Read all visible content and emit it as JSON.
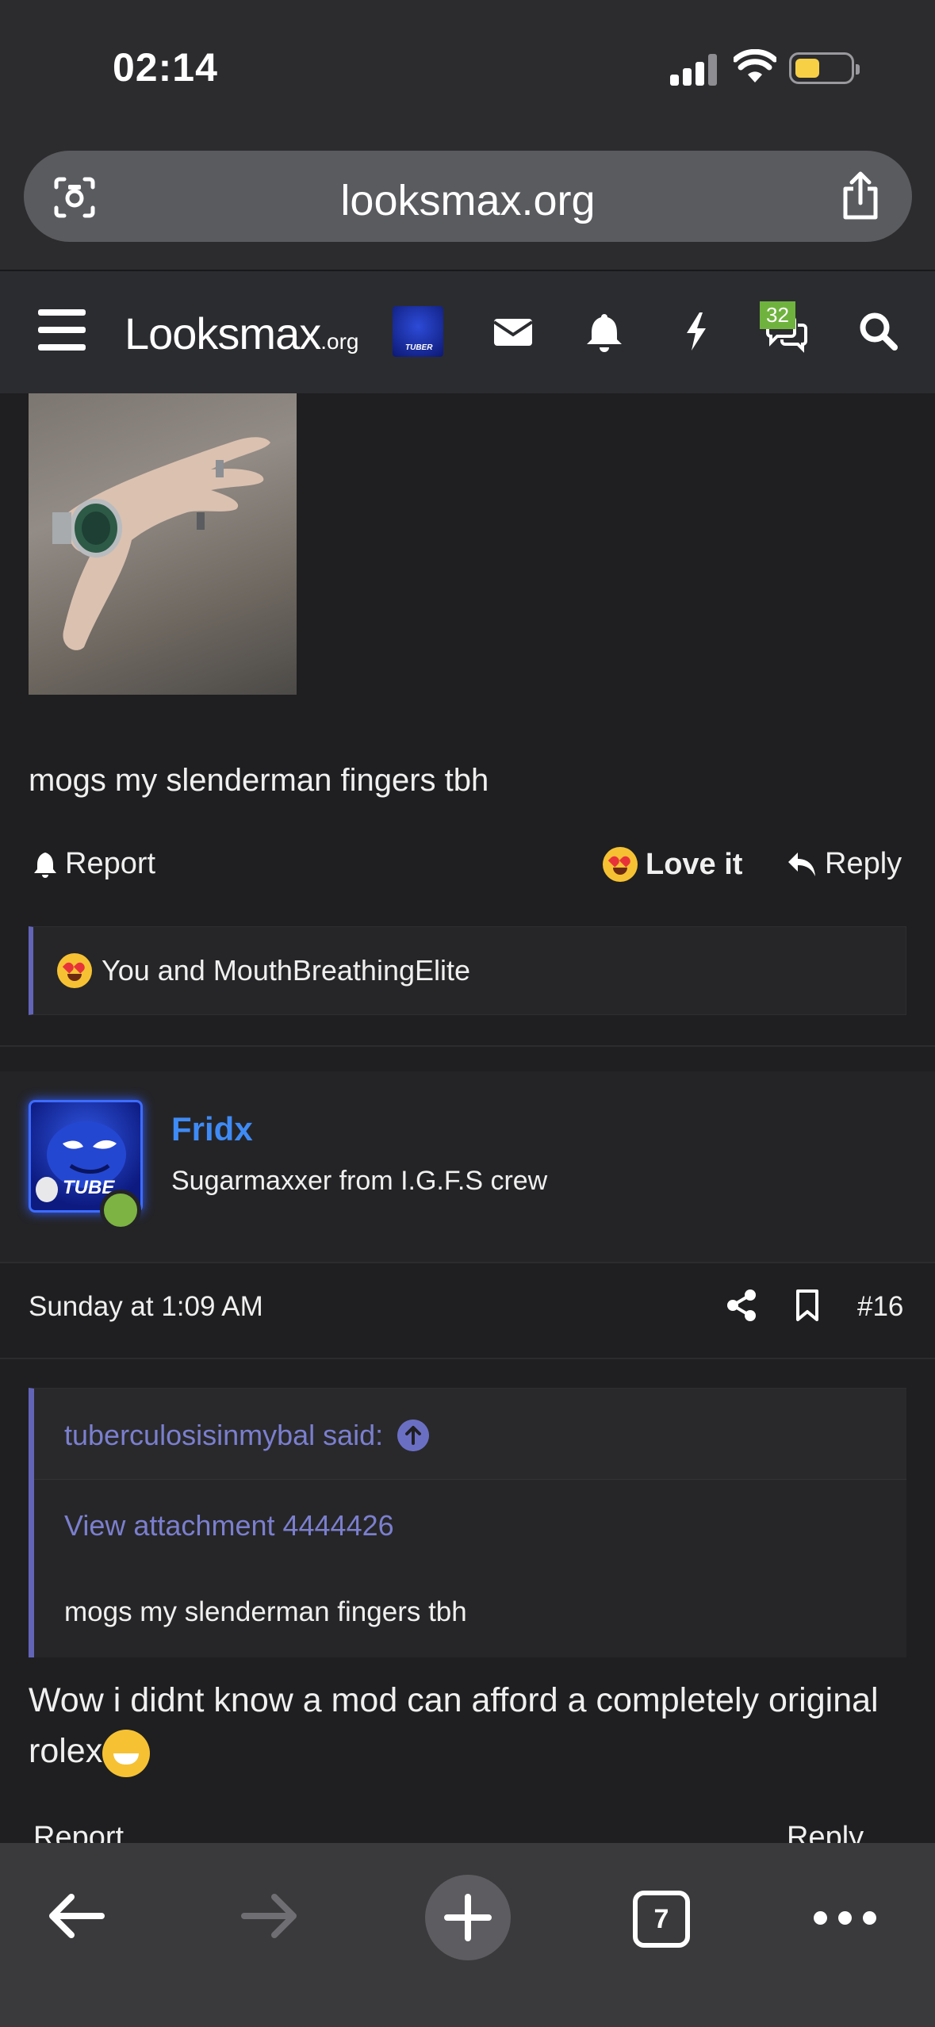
{
  "status_bar": {
    "time": "02:14"
  },
  "browser": {
    "url": "looksmax.org",
    "tab_count": "7"
  },
  "site_nav": {
    "logo_main": "Looksmax",
    "logo_suffix": ".org",
    "avatar_tag": "TUBER",
    "conversations_badge": "32"
  },
  "prev_post": {
    "text": "mogs my slenderman fingers tbh",
    "report_label": "Report",
    "love_label": "Love it",
    "reply_label": "Reply",
    "reactions_text": "You and MouthBreathingElite"
  },
  "post": {
    "username": "Fridx",
    "user_title": "Sugarmaxxer from I.G.F.S crew",
    "avatar_tag": "TUBE",
    "date": "Sunday at 1:09 AM",
    "number": "#16",
    "quote": {
      "author_line": "tuberculosisinmybal said:",
      "attachment_link": "View attachment 4444426",
      "text": "mogs my slenderman fingers tbh"
    },
    "body": "Wow i didnt know a mod can afford a completely original rolex",
    "report_label": "Report",
    "reply_label": "Reply"
  },
  "colors": {
    "accent_username": "#3f8bf5",
    "quote_border": "#6264b8",
    "badge": "#6fb33e"
  }
}
